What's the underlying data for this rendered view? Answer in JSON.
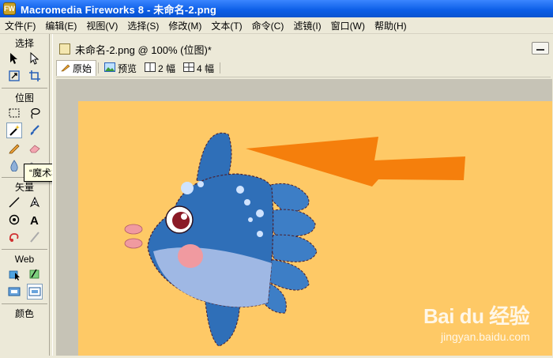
{
  "window": {
    "title": "Macromedia Fireworks 8 - 未命名-2.png",
    "app_icon_text": "FW"
  },
  "menu": [
    "文件(F)",
    "编辑(E)",
    "视图(V)",
    "选择(S)",
    "修改(M)",
    "文本(T)",
    "命令(C)",
    "滤镜(I)",
    "窗口(W)",
    "帮助(H)"
  ],
  "tools": {
    "sections": {
      "select": "选择",
      "bitmap": "位图",
      "vector": "矢量",
      "web": "Web",
      "colors": "颜色"
    },
    "active_tool": "magic-wand",
    "tooltip": "“魔术棒”工具 (W)"
  },
  "document": {
    "title": "未命名-2.png @ 100% (位图)*",
    "view_tabs": [
      "原始",
      "预览",
      "2 幅",
      "4 幅"
    ],
    "selected_view": "原始",
    "canvas_color": "#fec966"
  },
  "colors": {
    "arrow": "#f57f0c",
    "fish_dark": "#2f6fb8",
    "fish_belly": "#9fb8e4",
    "cheek": "#f09aa0"
  },
  "watermark": {
    "brand": "Bai du 经验",
    "url": "jingyan.baidu.com"
  }
}
